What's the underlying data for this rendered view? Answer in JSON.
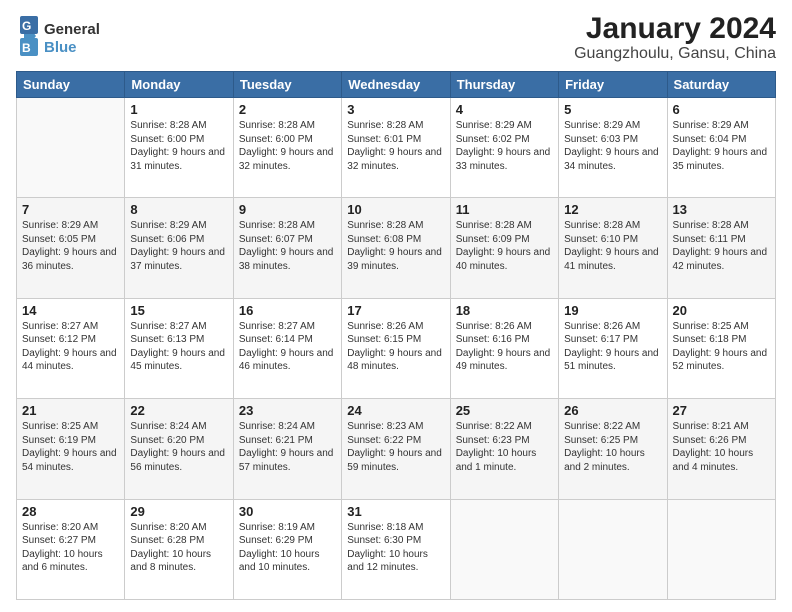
{
  "header": {
    "logo_general": "General",
    "logo_blue": "Blue",
    "title": "January 2024",
    "subtitle": "Guangzhoulu, Gansu, China"
  },
  "weekdays": [
    "Sunday",
    "Monday",
    "Tuesday",
    "Wednesday",
    "Thursday",
    "Friday",
    "Saturday"
  ],
  "weeks": [
    [
      null,
      {
        "day": 1,
        "rise": "8:28 AM",
        "set": "6:00 PM",
        "hours": "9 hours and 31 minutes."
      },
      {
        "day": 2,
        "rise": "8:28 AM",
        "set": "6:00 PM",
        "hours": "9 hours and 32 minutes."
      },
      {
        "day": 3,
        "rise": "8:28 AM",
        "set": "6:01 PM",
        "hours": "9 hours and 32 minutes."
      },
      {
        "day": 4,
        "rise": "8:29 AM",
        "set": "6:02 PM",
        "hours": "9 hours and 33 minutes."
      },
      {
        "day": 5,
        "rise": "8:29 AM",
        "set": "6:03 PM",
        "hours": "9 hours and 34 minutes."
      },
      {
        "day": 6,
        "rise": "8:29 AM",
        "set": "6:04 PM",
        "hours": "9 hours and 35 minutes."
      }
    ],
    [
      {
        "day": 7,
        "rise": "8:29 AM",
        "set": "6:05 PM",
        "hours": "9 hours and 36 minutes."
      },
      {
        "day": 8,
        "rise": "8:29 AM",
        "set": "6:06 PM",
        "hours": "9 hours and 37 minutes."
      },
      {
        "day": 9,
        "rise": "8:28 AM",
        "set": "6:07 PM",
        "hours": "9 hours and 38 minutes."
      },
      {
        "day": 10,
        "rise": "8:28 AM",
        "set": "6:08 PM",
        "hours": "9 hours and 39 minutes."
      },
      {
        "day": 11,
        "rise": "8:28 AM",
        "set": "6:09 PM",
        "hours": "9 hours and 40 minutes."
      },
      {
        "day": 12,
        "rise": "8:28 AM",
        "set": "6:10 PM",
        "hours": "9 hours and 41 minutes."
      },
      {
        "day": 13,
        "rise": "8:28 AM",
        "set": "6:11 PM",
        "hours": "9 hours and 42 minutes."
      }
    ],
    [
      {
        "day": 14,
        "rise": "8:27 AM",
        "set": "6:12 PM",
        "hours": "9 hours and 44 minutes."
      },
      {
        "day": 15,
        "rise": "8:27 AM",
        "set": "6:13 PM",
        "hours": "9 hours and 45 minutes."
      },
      {
        "day": 16,
        "rise": "8:27 AM",
        "set": "6:14 PM",
        "hours": "9 hours and 46 minutes."
      },
      {
        "day": 17,
        "rise": "8:26 AM",
        "set": "6:15 PM",
        "hours": "9 hours and 48 minutes."
      },
      {
        "day": 18,
        "rise": "8:26 AM",
        "set": "6:16 PM",
        "hours": "9 hours and 49 minutes."
      },
      {
        "day": 19,
        "rise": "8:26 AM",
        "set": "6:17 PM",
        "hours": "9 hours and 51 minutes."
      },
      {
        "day": 20,
        "rise": "8:25 AM",
        "set": "6:18 PM",
        "hours": "9 hours and 52 minutes."
      }
    ],
    [
      {
        "day": 21,
        "rise": "8:25 AM",
        "set": "6:19 PM",
        "hours": "9 hours and 54 minutes."
      },
      {
        "day": 22,
        "rise": "8:24 AM",
        "set": "6:20 PM",
        "hours": "9 hours and 56 minutes."
      },
      {
        "day": 23,
        "rise": "8:24 AM",
        "set": "6:21 PM",
        "hours": "9 hours and 57 minutes."
      },
      {
        "day": 24,
        "rise": "8:23 AM",
        "set": "6:22 PM",
        "hours": "9 hours and 59 minutes."
      },
      {
        "day": 25,
        "rise": "8:22 AM",
        "set": "6:23 PM",
        "hours": "10 hours and 1 minute."
      },
      {
        "day": 26,
        "rise": "8:22 AM",
        "set": "6:25 PM",
        "hours": "10 hours and 2 minutes."
      },
      {
        "day": 27,
        "rise": "8:21 AM",
        "set": "6:26 PM",
        "hours": "10 hours and 4 minutes."
      }
    ],
    [
      {
        "day": 28,
        "rise": "8:20 AM",
        "set": "6:27 PM",
        "hours": "10 hours and 6 minutes."
      },
      {
        "day": 29,
        "rise": "8:20 AM",
        "set": "6:28 PM",
        "hours": "10 hours and 8 minutes."
      },
      {
        "day": 30,
        "rise": "8:19 AM",
        "set": "6:29 PM",
        "hours": "10 hours and 10 minutes."
      },
      {
        "day": 31,
        "rise": "8:18 AM",
        "set": "6:30 PM",
        "hours": "10 hours and 12 minutes."
      },
      null,
      null,
      null
    ]
  ],
  "labels": {
    "sunrise": "Sunrise:",
    "sunset": "Sunset:",
    "daylight": "Daylight:"
  }
}
